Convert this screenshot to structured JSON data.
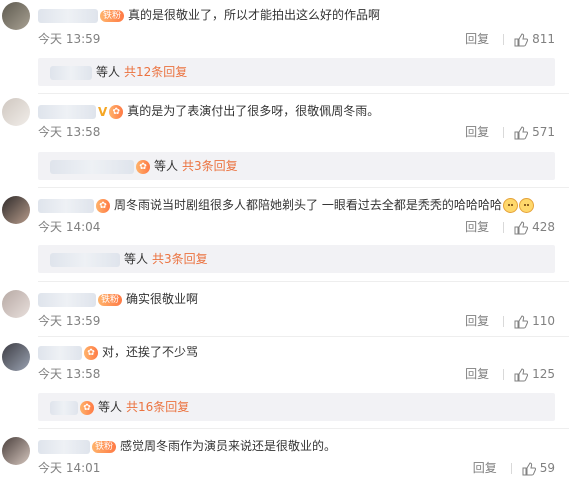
{
  "comments": [
    {
      "text": "真的是很敬业了，所以才能拍出这么好的作品啊",
      "badge": "铁粉",
      "time": "今天 13:59",
      "reply_label": "回复",
      "likes": "811",
      "sub": {
        "who": "等人",
        "count": "共12条回复"
      }
    },
    {
      "text": "真的是为了表演付出了很多呀，很敬佩周冬雨。",
      "badge": "V",
      "time": "今天 13:58",
      "reply_label": "回复",
      "likes": "571",
      "sub": {
        "who": "等人",
        "count": "共3条回复"
      }
    },
    {
      "text": "周冬雨说当时剧组很多人都陪她剃头了 一眼看过去全都是秃秃的哈哈哈哈",
      "badge": "",
      "time": "今天 14:04",
      "reply_label": "回复",
      "likes": "428",
      "sub": {
        "who": "等人",
        "count": "共3条回复"
      }
    },
    {
      "text": "确实很敬业啊",
      "badge": "铁粉",
      "time": "今天 13:59",
      "reply_label": "回复",
      "likes": "110"
    },
    {
      "text": "对，还挨了不少骂",
      "badge": "",
      "time": "今天 13:58",
      "reply_label": "回复",
      "likes": "125",
      "sub": {
        "who": "等人",
        "count": "共16条回复"
      }
    },
    {
      "text": "感觉周冬雨作为演员来说还是很敬业的。",
      "badge": "铁粉",
      "time": "今天 14:01",
      "reply_label": "回复",
      "likes": "59"
    }
  ],
  "colors": {
    "accent": "#eb7340",
    "meta": "#808080",
    "subbar_bg": "#f2f2f5"
  },
  "icons": {
    "like": "thumbs-up-icon"
  }
}
